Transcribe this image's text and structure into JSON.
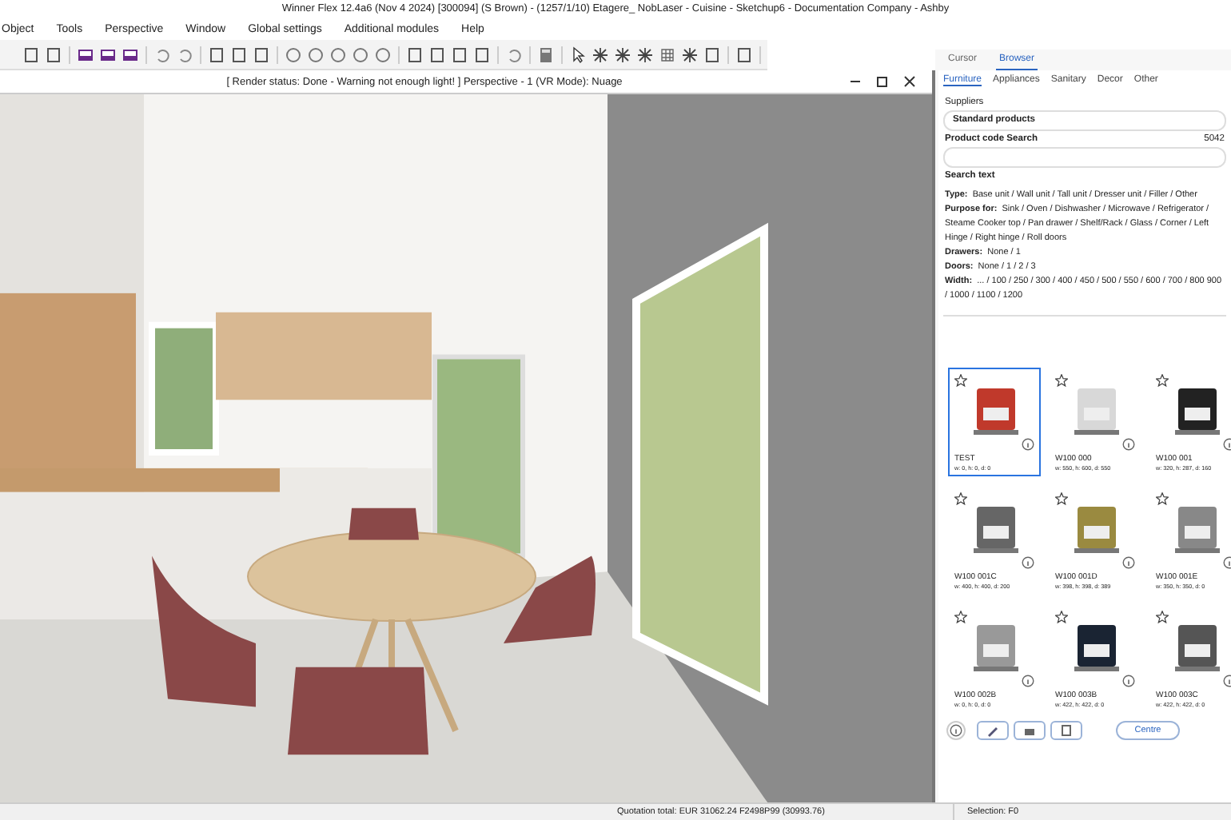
{
  "window": {
    "title": "Winner Flex 12.4a6  (Nov  4 2024) [300094]  (S Brown) - (1257/1/10) Etagere_ NobLaser - Cuisine - Sketchup6 - Documentation Company - Ashby"
  },
  "menu": [
    "Object",
    "Tools",
    "Perspective",
    "Window",
    "Global settings",
    "Additional modules",
    "Help"
  ],
  "viewport": {
    "header": "[ Render status: Done - Warning not enough light! ] Perspective - 1 (VR Mode): Nuage"
  },
  "panel": {
    "tabs": [
      {
        "label": "Cursor",
        "selected": false
      },
      {
        "label": "Browser",
        "selected": true
      }
    ],
    "categories": [
      {
        "label": "Furniture",
        "selected": true
      },
      {
        "label": "Appliances",
        "selected": false
      },
      {
        "label": "Sanitary",
        "selected": false
      },
      {
        "label": "Decor",
        "selected": false
      },
      {
        "label": "Other",
        "selected": false
      }
    ],
    "suppliers_label": "Suppliers",
    "supplier": "Standard products",
    "code_label": "Product code Search",
    "code_count": "5042",
    "search_label": "Search text",
    "filters": [
      {
        "label": "Type:",
        "values": "Base unit / Wall unit / Tall unit / Dresser unit / Filler / Other"
      },
      {
        "label": "Purpose for:",
        "values": "Sink / Oven / Dishwasher / Microwave / Refrigerator / Steame Cooker top / Pan drawer / Shelf/Rack / Glass / Corner / Left Hinge / Right hinge / Roll doors"
      },
      {
        "label": "Drawers:",
        "values": "None / 1"
      },
      {
        "label": "Doors:",
        "values": "None / 1 / 2 / 3"
      },
      {
        "label": "Width:",
        "values": "... / 100 / 250 / 300 / 400 / 450 / 500 / 550 / 600 / 700 / 800 900 / 1000 / 1100 / 1200"
      }
    ],
    "products": [
      {
        "name": "TEST",
        "dims": "w: 0, h: 0, d: 0",
        "selected": true
      },
      {
        "name": "W100 000",
        "dims": "w: 550, h: 600, d: 550",
        "selected": false
      },
      {
        "name": "W100 001",
        "dims": "w: 320, h: 287, d: 160",
        "selected": false
      },
      {
        "name": "W100 001C",
        "dims": "w: 400, h: 400, d: 200",
        "selected": false
      },
      {
        "name": "W100 001D",
        "dims": "w: 398, h: 398, d: 389",
        "selected": false
      },
      {
        "name": "W100 001E",
        "dims": "w: 350, h: 350, d: 0",
        "selected": false
      },
      {
        "name": "W100 002B",
        "dims": "w: 0, h: 0, d: 0",
        "selected": false
      },
      {
        "name": "W100 003B",
        "dims": "w: 422, h: 422, d: 0",
        "selected": false
      },
      {
        "name": "W100 003C",
        "dims": "w: 422, h: 422, d: 0",
        "selected": false
      }
    ],
    "centre_button": "Centre"
  },
  "status_bar": {
    "quotation": "Quotation total: EUR 31062.24  F2498P99 (30993.76)",
    "selection": "Selection: F0"
  }
}
